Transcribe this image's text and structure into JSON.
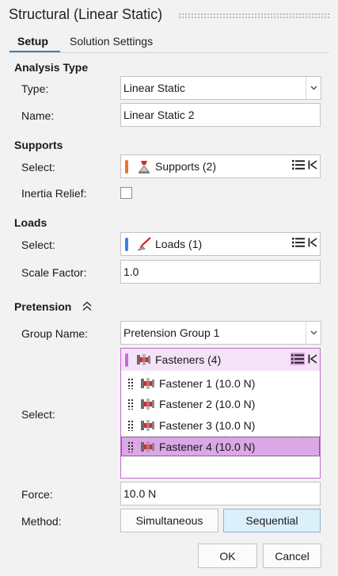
{
  "dialog": {
    "title": "Structural (Linear Static)"
  },
  "tabs": [
    {
      "label": "Setup",
      "active": true
    },
    {
      "label": "Solution Settings",
      "active": false
    }
  ],
  "analysis_type": {
    "heading": "Analysis Type",
    "type_label": "Type:",
    "type_value": "Linear Static",
    "name_label": "Name:",
    "name_value": "Linear Static 2"
  },
  "supports": {
    "heading": "Supports",
    "select_label": "Select:",
    "select_value": "Supports (2)",
    "color": "#e8742b",
    "inertia_relief_label": "Inertia Relief:",
    "inertia_relief_checked": false
  },
  "loads": {
    "heading": "Loads",
    "select_label": "Select:",
    "select_value": "Loads (1)",
    "color": "#3a82e8",
    "scale_factor_label": "Scale Factor:",
    "scale_factor_value": "1.0"
  },
  "pretension": {
    "heading": "Pretension",
    "group_name_label": "Group Name:",
    "group_name_value": "Pretension Group 1",
    "select_label": "Select:",
    "select_value": "Fasteners (4)",
    "color": "#c86ad6",
    "items": [
      {
        "label": "Fastener 1 (10.0 N)",
        "selected": false
      },
      {
        "label": "Fastener 2 (10.0 N)",
        "selected": false
      },
      {
        "label": "Fastener 3 (10.0 N)",
        "selected": false
      },
      {
        "label": "Fastener 4 (10.0 N)",
        "selected": true
      }
    ],
    "force_label": "Force:",
    "force_value": "10.0 N",
    "method_label": "Method:",
    "method_options": [
      "Simultaneous",
      "Sequential"
    ],
    "method_selected": "Sequential"
  },
  "footer": {
    "ok_label": "OK",
    "cancel_label": "Cancel"
  },
  "icons": {
    "dropdown": "chevron-down-icon",
    "list": "list-icon",
    "reset": "reset-selection-icon",
    "supports": "support-icon",
    "loads": "load-icon",
    "fastener": "fastener-icon",
    "collapse": "double-chevron-up-icon"
  }
}
